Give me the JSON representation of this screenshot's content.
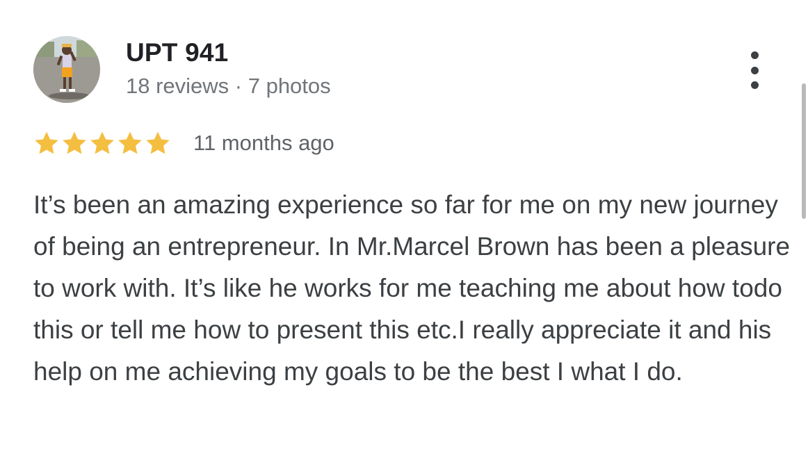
{
  "review": {
    "author_name": "UPT 941",
    "author_meta": "18 reviews · 7 photos",
    "rating": 5,
    "rating_max": 5,
    "star_color": "#f4be41",
    "date": "11 months ago",
    "text": "It’s been an amazing experience so far for me on my new journey of being an entrepreneur. In Mr.Marcel Brown has been a pleasure to work with. It’s like he works for me teaching me about how todo this or tell me how to present this etc.I really appreciate it and his help on me achieving my goals to be the best I what I do."
  },
  "icons": {
    "more": "more-vert-icon",
    "star": "star-icon"
  }
}
